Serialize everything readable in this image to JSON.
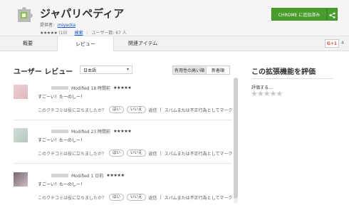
{
  "header": {
    "title": "ジャパリペディア",
    "offered_by_label": "提供者:",
    "author": "miyacka",
    "stars": "★★★★★",
    "rating_count": "(10)",
    "category": "検索",
    "users": "ユーザー数: 67 人",
    "install_label": "CHROME に追加済み",
    "share_icon": "share-icon"
  },
  "tabs": [
    {
      "label": "概要"
    },
    {
      "label": "レビュー"
    },
    {
      "label": "関連アイテム"
    }
  ],
  "gplus": {
    "label": "G+1",
    "count": "4"
  },
  "reviews_section": {
    "title": "ユーザー レビュー",
    "language": "日本語",
    "sort_options": [
      "有用性の高い順",
      "新着順"
    ]
  },
  "reviews": [
    {
      "modified": "Modified 18 時間前",
      "stars": "★★★★★",
      "text": "すごーい！たーのしー！",
      "helpful_question": "このクチコミは役に立ちましたか？",
      "yes": "はい",
      "no": "いいえ",
      "reply": "返信",
      "spam": "スパムまたは不正行為としてマーク"
    },
    {
      "modified": "Modified 23 時間前",
      "stars": "★★★★★",
      "text": "すごーい！たーのしー！",
      "helpful_question": "このクチコミは役に立ちましたか？",
      "yes": "はい",
      "no": "いいえ",
      "reply": "返信",
      "spam": "スパムまたは不正行為としてマーク"
    },
    {
      "modified": "Modified 1 日前",
      "stars": "★★★★★",
      "text": "すごーい！たーのしー！",
      "helpful_question": "このクチコミは役に立ちましたか？",
      "yes": "はい",
      "no": "いいえ",
      "reply": "返信",
      "spam": "スパムまたは不正行為としてマーク"
    }
  ],
  "rate": {
    "title": "この拡張機能を評価",
    "label": "評価する...",
    "stars": "★★★★★"
  },
  "colors": {
    "install_green": "#4a9e2e",
    "link_blue": "#1155cc"
  }
}
